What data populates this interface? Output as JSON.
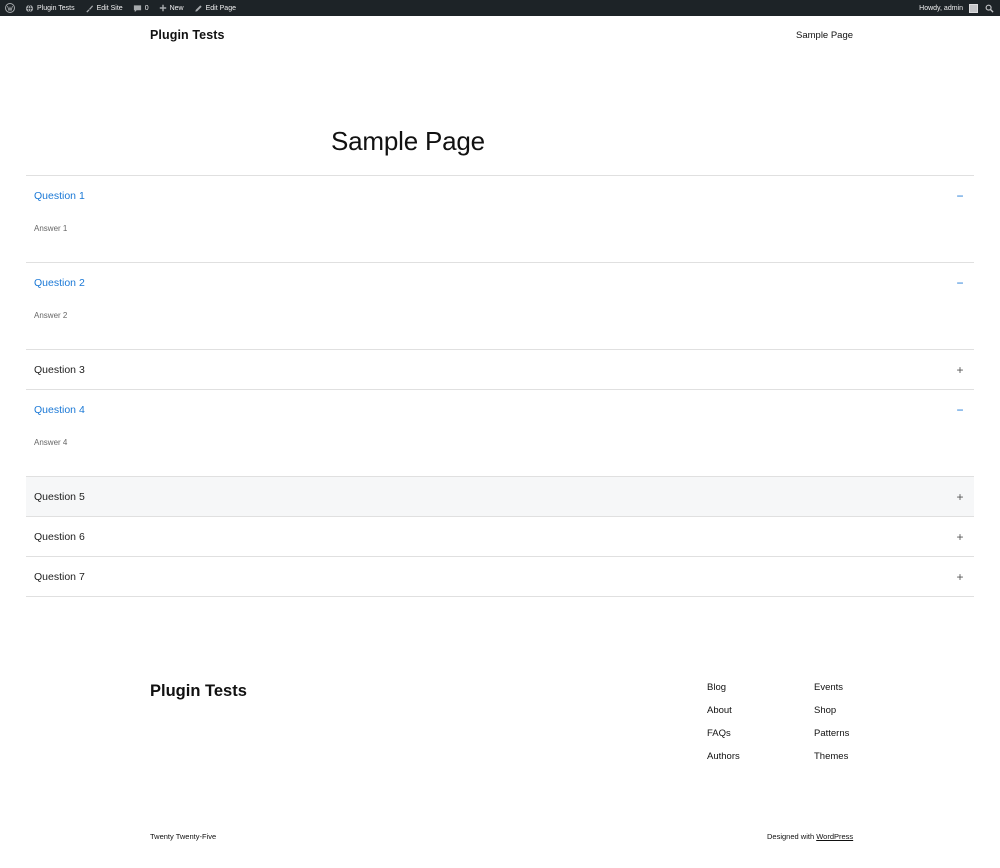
{
  "adminbar": {
    "site": "Plugin Tests",
    "edit_site": "Edit Site",
    "comments_count": "0",
    "new": "New",
    "edit_page": "Edit Page",
    "greeting": "Howdy, admin"
  },
  "header": {
    "site_title": "Plugin Tests",
    "nav": [
      "Sample Page"
    ]
  },
  "page": {
    "title": "Sample Page"
  },
  "faq": {
    "items": [
      {
        "question": "Question 1",
        "answer": "Answer 1",
        "open": true
      },
      {
        "question": "Question 2",
        "answer": "Answer 2",
        "open": true
      },
      {
        "question": "Question 3",
        "answer": "",
        "open": false
      },
      {
        "question": "Question 4",
        "answer": "Answer 4",
        "open": true
      },
      {
        "question": "Question 5",
        "answer": "",
        "open": false
      },
      {
        "question": "Question 6",
        "answer": "",
        "open": false
      },
      {
        "question": "Question 7",
        "answer": "",
        "open": false
      }
    ],
    "open_symbol": "−",
    "closed_symbol": "+"
  },
  "footer": {
    "site_title": "Plugin Tests",
    "links": [
      "Blog",
      "Events",
      "About",
      "Shop",
      "FAQs",
      "Patterns",
      "Authors",
      "Themes"
    ],
    "theme_name": "Twenty Twenty-Five",
    "designed_with": "Designed with ",
    "designed_link": "WordPress"
  },
  "colors": {
    "accent": "#1a78d6",
    "adminbar_bg": "#1d2327"
  }
}
